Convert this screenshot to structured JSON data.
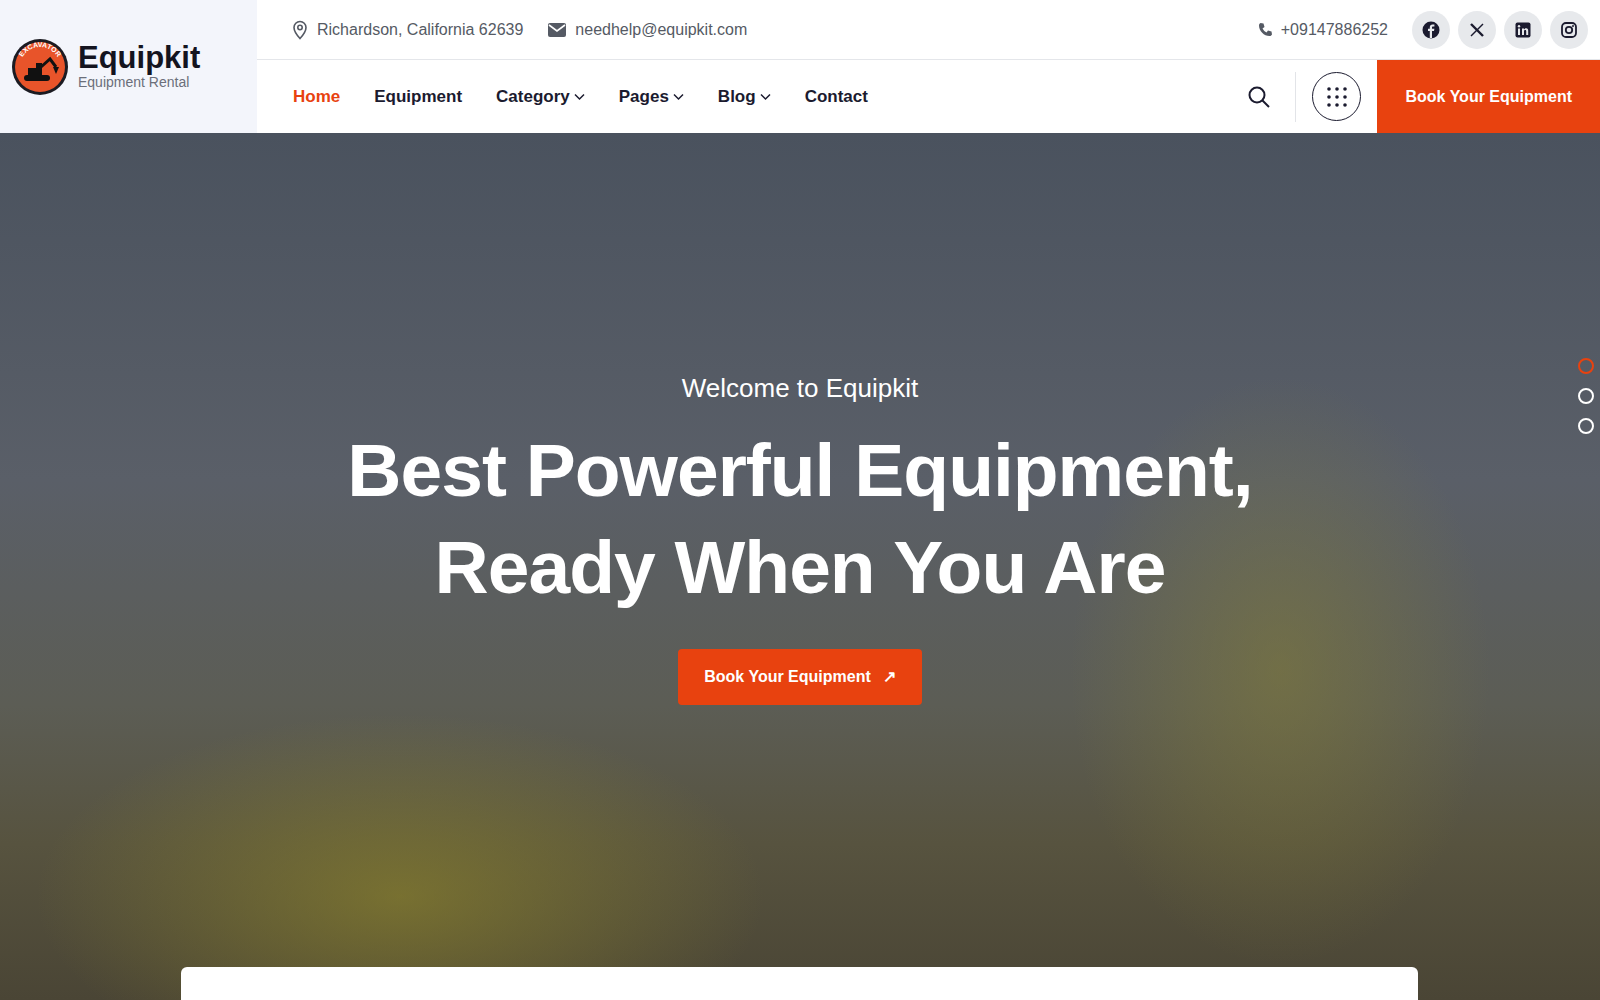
{
  "logo": {
    "name": "Equipkit",
    "tagline": "Equipment Rental",
    "badge": "EXCAVATOR"
  },
  "topbar": {
    "address": "Richardson, California 62639",
    "email": "needhelp@equipkit.com",
    "phone": "+09147886252"
  },
  "nav": {
    "items": [
      {
        "label": "Home",
        "selected": true,
        "has_menu": false
      },
      {
        "label": "Equipment",
        "selected": false,
        "has_menu": false
      },
      {
        "label": "Category",
        "selected": false,
        "has_menu": true
      },
      {
        "label": "Pages",
        "selected": false,
        "has_menu": true
      },
      {
        "label": "Blog",
        "selected": false,
        "has_menu": true
      },
      {
        "label": "Contact",
        "selected": false,
        "has_menu": false
      }
    ]
  },
  "header_button": "Book Your Equipment",
  "hero": {
    "subtitle": "Welcome to Equipkit",
    "title_lines": [
      "Best Powerful Equipment,",
      "Ready When You Are"
    ],
    "button": "Book Your Equipment",
    "button_icon": "↗"
  },
  "slider_dots": [
    {
      "selected": true
    },
    {
      "selected": false
    },
    {
      "selected": false
    }
  ]
}
